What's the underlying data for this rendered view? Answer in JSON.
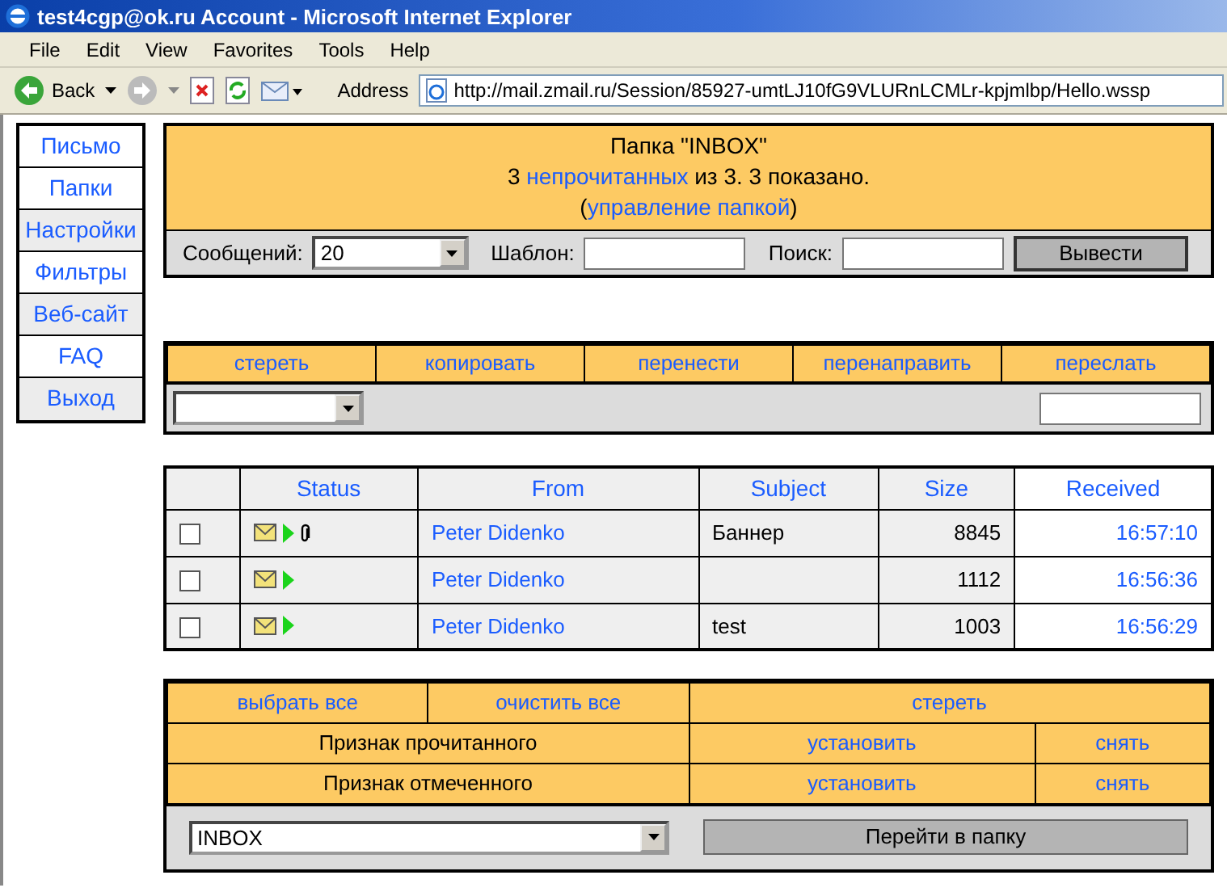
{
  "window": {
    "title": "test4cgp@ok.ru Account - Microsoft Internet Explorer"
  },
  "menu": [
    "File",
    "Edit",
    "View",
    "Favorites",
    "Tools",
    "Help"
  ],
  "toolbar": {
    "back": "Back",
    "address_label": "Address",
    "url": "http://mail.zmail.ru/Session/85927-umtLJ10fG9VLURnLCMLr-kpjmlbp/Hello.wssp"
  },
  "sidebar": {
    "items": [
      {
        "label": "Письмо",
        "shaded": false
      },
      {
        "label": "Папки",
        "shaded": false
      },
      {
        "label": "Настройки",
        "shaded": true
      },
      {
        "label": "Фильтры",
        "shaded": false
      },
      {
        "label": "Веб-сайт",
        "shaded": true
      },
      {
        "label": "FAQ",
        "shaded": false
      },
      {
        "label": "Выход",
        "shaded": true
      }
    ]
  },
  "folder": {
    "title": "Папка \"INBOX\"",
    "count": "3",
    "unread_link": "непрочитанных",
    "summary": "из 3. 3 показано.",
    "manage_open": "(",
    "manage_link": "управление папкой",
    "manage_close": ")"
  },
  "filter": {
    "messages_label": "Сообщений:",
    "messages_value": "20",
    "template_label": "Шаблон:",
    "search_label": "Поиск:",
    "button": "Вывести"
  },
  "actions": {
    "links": [
      "стереть",
      "копировать",
      "перенести",
      "перенаправить",
      "переслать"
    ]
  },
  "messages": {
    "columns": [
      {
        "label": "Status",
        "sorted": false
      },
      {
        "label": "From",
        "sorted": false
      },
      {
        "label": "Subject",
        "sorted": false
      },
      {
        "label": "Size",
        "sorted": false
      },
      {
        "label": "Received",
        "sorted": true
      }
    ],
    "rows": [
      {
        "checked": false,
        "attachment": true,
        "from": "Peter Didenko",
        "subject": "Баннер",
        "size": "8845",
        "received": "16:57:10"
      },
      {
        "checked": false,
        "attachment": false,
        "from": "Peter Didenko",
        "size": "1112",
        "received": "16:56:36"
      },
      {
        "checked": false,
        "attachment": false,
        "from": "Peter Didenko",
        "subject": "test",
        "size": "1003",
        "received": "16:56:29"
      }
    ]
  },
  "bulk": {
    "select_all": "выбрать все",
    "clear_all": "очистить все",
    "delete": "стереть",
    "flags": [
      {
        "label": "Признак прочитанного",
        "set": "установить",
        "unset": "снять"
      },
      {
        "label": "Признак отмеченного",
        "set": "установить",
        "unset": "снять"
      }
    ],
    "folder_value": "INBOX",
    "go_button": "Перейти в папку"
  }
}
